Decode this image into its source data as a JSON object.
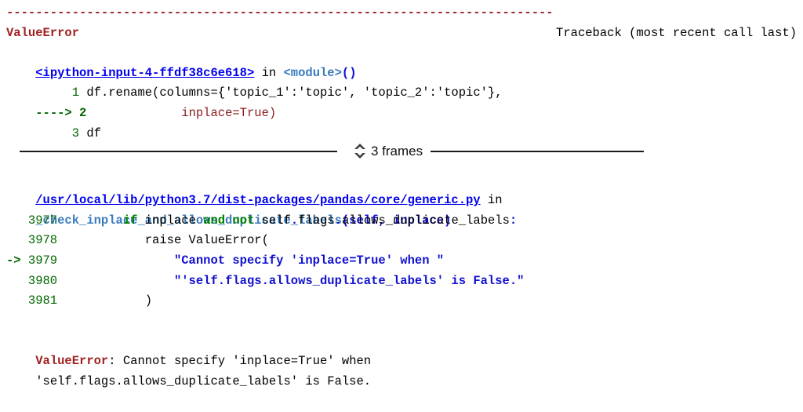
{
  "traceback": {
    "separator_top": "---------------------------------------------------------------------------",
    "header": {
      "exception_name": "ValueError",
      "traceback_label": "Traceback (most recent call last)"
    },
    "frame_user": {
      "file_link": "<ipython-input-4-ffdf38c6e618>",
      "in_keyword": " in ",
      "func_name": "<module>",
      "func_parens": "()",
      "lines": [
        {
          "marker": "     ",
          "number": "1",
          "code_plain": " df.rename(columns={'topic_1':'topic', 'topic_2':'topic'},"
        },
        {
          "marker": "----> ",
          "number": "2",
          "code_pre": "             ",
          "code_exec": "inplace=True)"
        },
        {
          "marker": "     ",
          "number": "3",
          "code_plain": " df"
        }
      ]
    },
    "frames_collapse": {
      "label": "3 frames",
      "chevron_up": "chevron-up-icon",
      "chevron_down": "chevron-down-icon"
    },
    "frame_lib": {
      "file_link": "/usr/local/lib/python3.7/dist-packages/pandas/core/generic.py",
      "in_keyword": " in ",
      "func_name": "_check_inplace_and_allows_duplicate_labels",
      "func_args": "(self, inplace)",
      "lines": [
        {
          "marker": "   ",
          "number": "3977",
          "segments": [
            {
              "t": " ",
              "c": "plain"
            },
            {
              "t": "        ",
              "c": "plain"
            },
            {
              "t": "if",
              "c": "kw"
            },
            {
              "t": " inplace ",
              "c": "plain"
            },
            {
              "t": "and",
              "c": "kw"
            },
            {
              "t": " ",
              "c": "plain"
            },
            {
              "t": "not",
              "c": "kw"
            },
            {
              "t": " self",
              "c": "plain"
            },
            {
              "t": ".",
              "c": "op"
            },
            {
              "t": "flags",
              "c": "plain"
            },
            {
              "t": ".",
              "c": "op"
            },
            {
              "t": "allows_duplicate_labels",
              "c": "plain"
            },
            {
              "t": ":",
              "c": "op"
            }
          ]
        },
        {
          "marker": "   ",
          "number": "3978",
          "segments": [
            {
              "t": "            raise ValueError(",
              "c": "plain"
            }
          ]
        },
        {
          "marker": "-> ",
          "number": "3979",
          "segments": [
            {
              "t": "                ",
              "c": "plain"
            },
            {
              "t": "\"Cannot specify 'inplace=True' when \"",
              "c": "string"
            }
          ]
        },
        {
          "marker": "   ",
          "number": "3980",
          "segments": [
            {
              "t": "                ",
              "c": "plain"
            },
            {
              "t": "\"'self.flags.allows_duplicate_labels' is False.\"",
              "c": "string"
            }
          ]
        },
        {
          "marker": "   ",
          "number": "3981",
          "segments": [
            {
              "t": "            )",
              "c": "plain"
            }
          ]
        }
      ]
    },
    "final_message": {
      "exception_name": "ValueError",
      "colon": ": ",
      "text_line1": "Cannot specify 'inplace=True' when",
      "text_line2": "'self.flags.allows_duplicate_labels' is False."
    }
  },
  "colors": {
    "error_red": "#a02020",
    "link_blue": "#0000ee",
    "string_blue": "#1010d0",
    "keyword_green": "#008000",
    "lineno_green": "#006600",
    "func_blue": "#3a7bbd",
    "exec_red": "#8b1a1a",
    "background": "#ffffff"
  }
}
